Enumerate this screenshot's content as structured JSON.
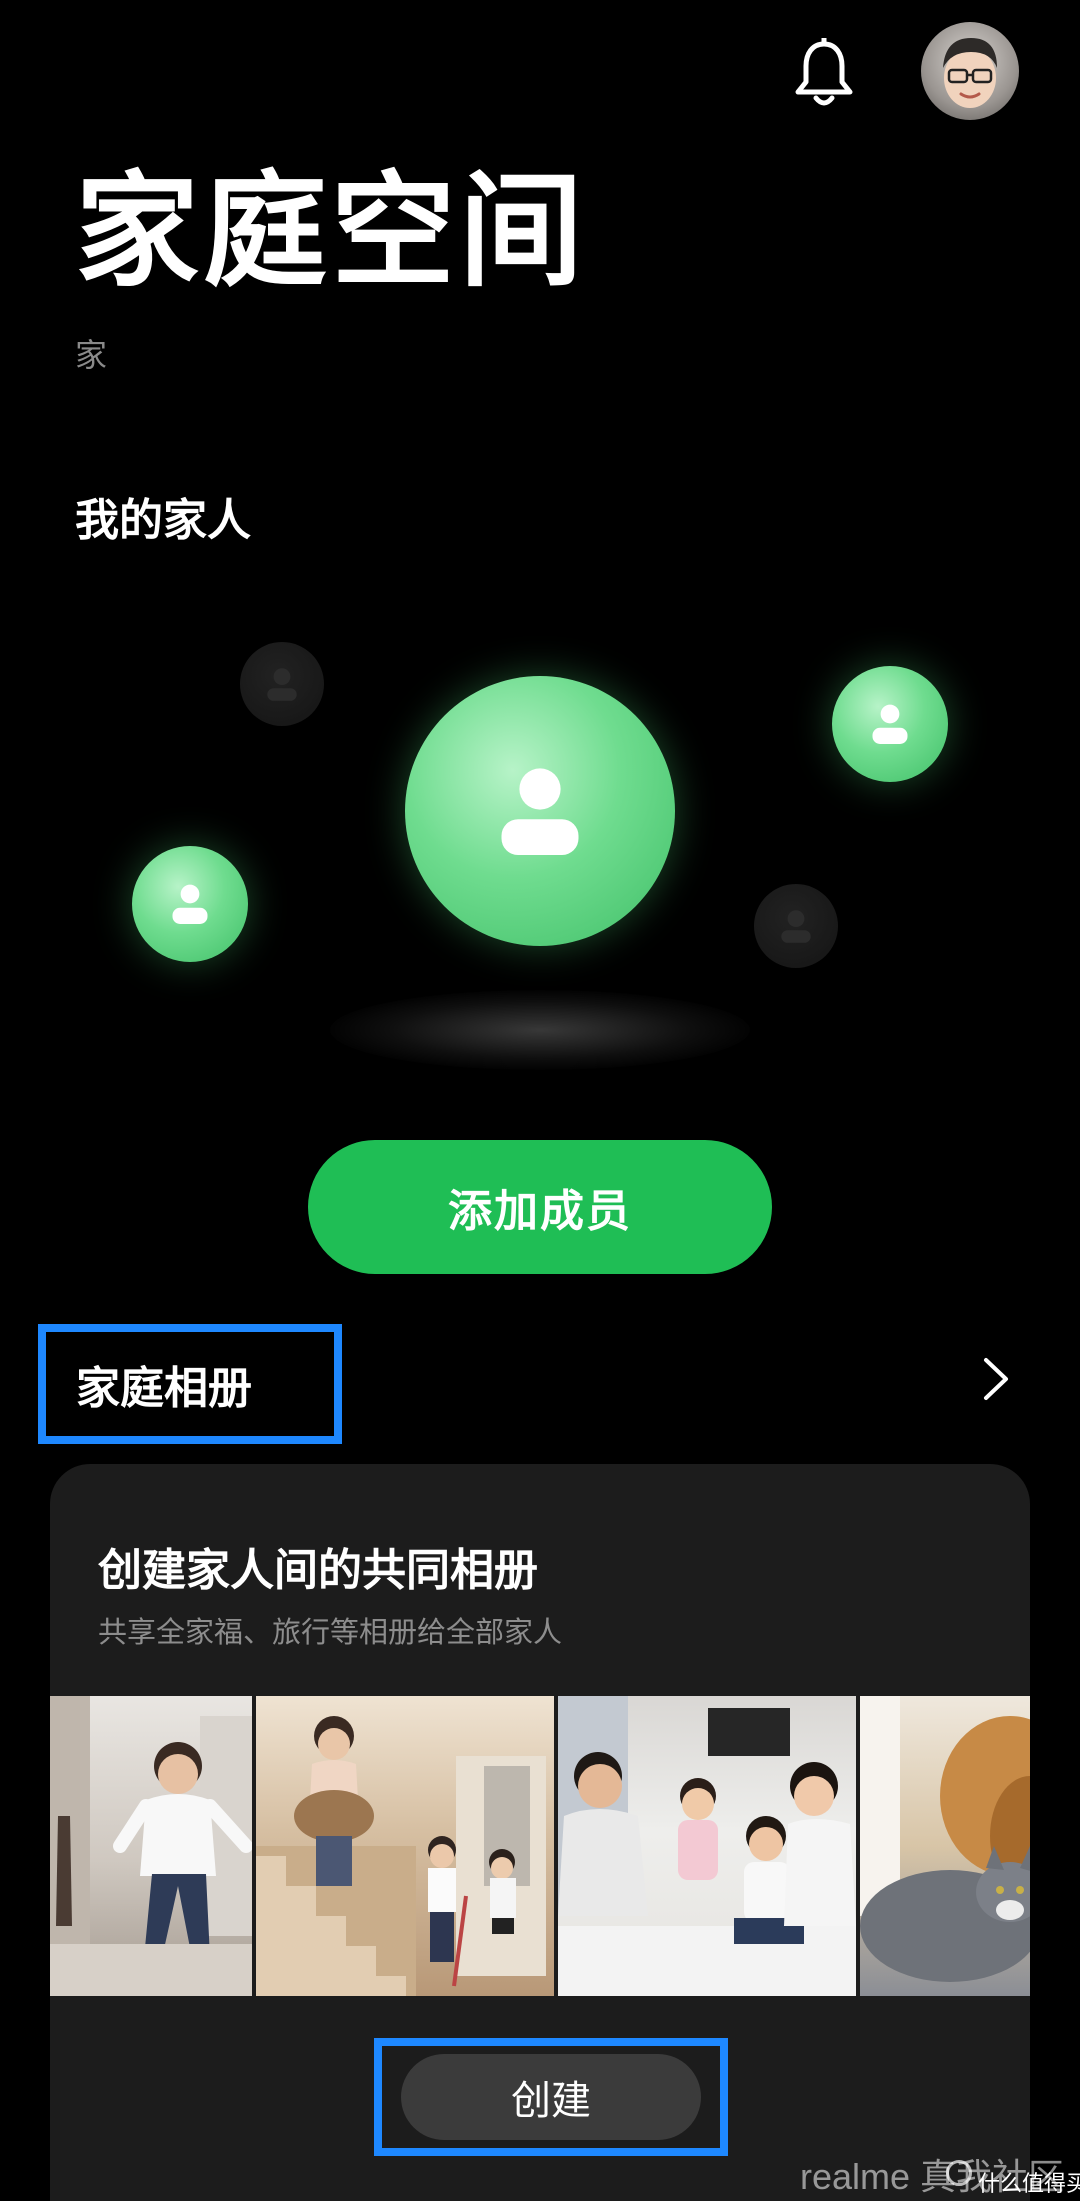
{
  "header": {
    "title": "家庭空间",
    "subtitle": "家",
    "bell_icon": "bell-icon",
    "avatar_icon": "avatar"
  },
  "members": {
    "heading": "我的家人",
    "add_button_label": "添加成员",
    "accent_color": "#1fbe55"
  },
  "album": {
    "section_label": "家庭相册",
    "card_title": "创建家人间的共同相册",
    "card_subtitle": "共享全家福、旅行等相册给全部家人",
    "create_button_label": "创建",
    "highlight_color": "#1e88ff"
  },
  "watermark": {
    "text": "realme 真我社区",
    "brand": "什么值得买"
  }
}
